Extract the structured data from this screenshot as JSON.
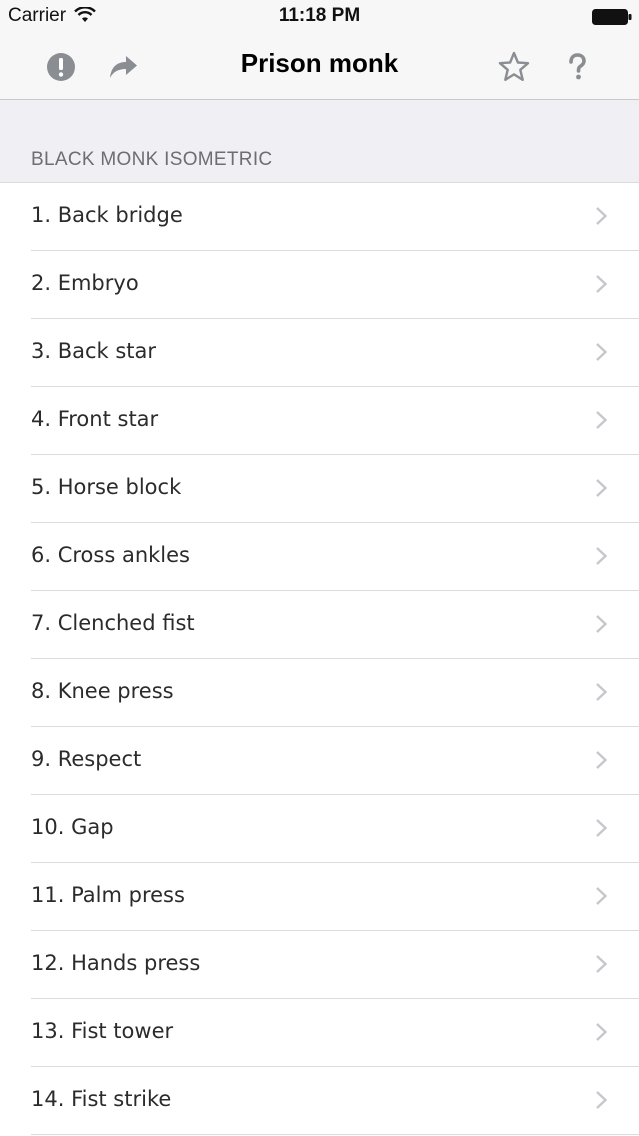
{
  "status_bar": {
    "carrier": "Carrier",
    "time": "11:18 PM"
  },
  "nav": {
    "title": "Prison monk",
    "left_icons": [
      "exclamation-icon",
      "share-arrow-icon"
    ],
    "right_icons": [
      "star-icon",
      "question-icon"
    ]
  },
  "section": {
    "title": "BLACK MONK ISOMETRIC"
  },
  "items": [
    {
      "label": "1. Back bridge"
    },
    {
      "label": "2. Embryo"
    },
    {
      "label": "3. Back star"
    },
    {
      "label": "4. Front star"
    },
    {
      "label": "5. Horse block"
    },
    {
      "label": "6. Cross ankles"
    },
    {
      "label": "7. Clenched fist"
    },
    {
      "label": "8. Knee press"
    },
    {
      "label": "9. Respect"
    },
    {
      "label": "10. Gap"
    },
    {
      "label": "11. Palm press"
    },
    {
      "label": "12. Hands press"
    },
    {
      "label": "13. Fist tower"
    },
    {
      "label": "14. Fist strike"
    }
  ],
  "colors": {
    "icon_gray": "#8a8d91",
    "chevron": "#c7c7cc",
    "separator": "#dcdce0"
  }
}
